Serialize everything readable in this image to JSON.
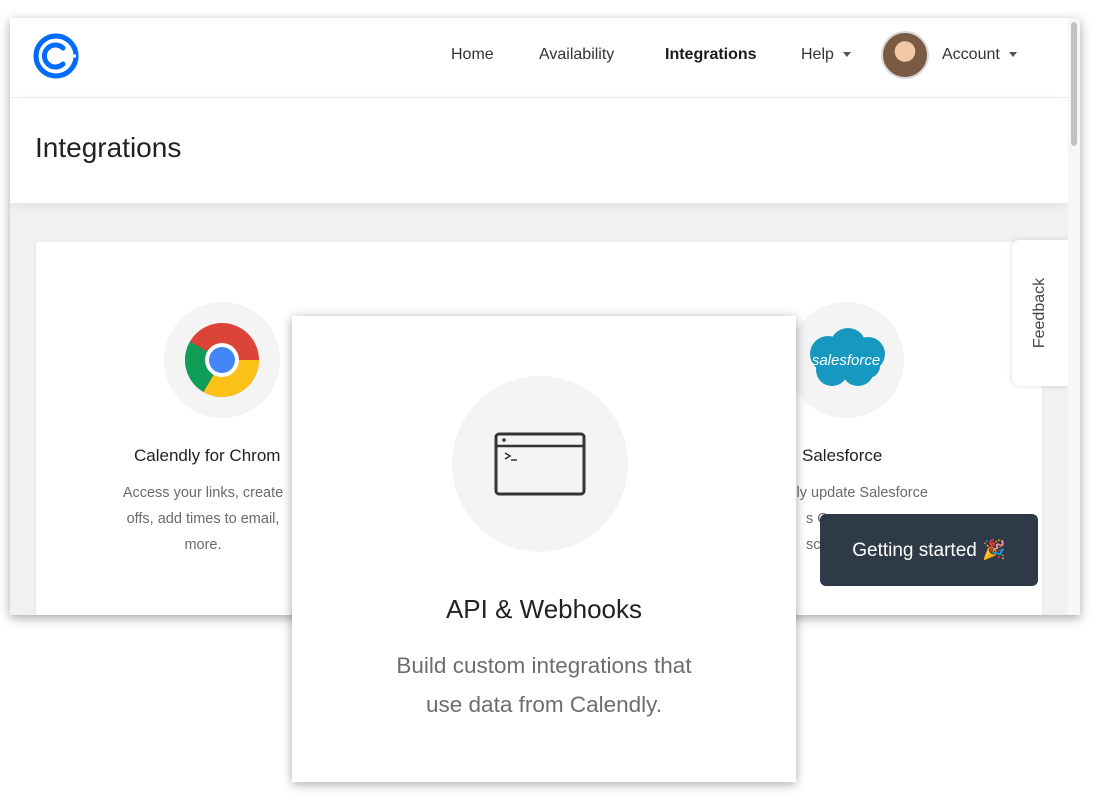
{
  "header": {
    "nav": {
      "home": "Home",
      "availability": "Availability",
      "integrations": "Integrations",
      "help": "Help",
      "account": "Account"
    }
  },
  "page": {
    "title": "Integrations"
  },
  "integrations": [
    {
      "title": "Calendly for Chrom",
      "desc_lines": [
        "Access your links, create",
        "offs, add times to email,",
        "more."
      ]
    },
    {
      "title": "Salesforce",
      "desc_lines": [
        "cally update Salesforce",
        "s Ca",
        "sc"
      ]
    }
  ],
  "feedback": {
    "label": "Feedback"
  },
  "getting_started": {
    "label": "Getting started 🎉"
  },
  "api_card": {
    "title": "API & Webhooks",
    "desc_line1": "Build custom integrations that",
    "desc_line2": "use data from Calendly."
  },
  "icons": {
    "logo": "calendly-logo",
    "chrome": "chrome-icon",
    "salesforce": "salesforce-icon",
    "api": "terminal-window-icon"
  },
  "brand": {
    "salesforce_text": "salesforce"
  },
  "colors": {
    "calendly_blue": "#006bff",
    "salesforce_blue": "#1798c1",
    "getting_started_bg": "#2f3a48"
  }
}
